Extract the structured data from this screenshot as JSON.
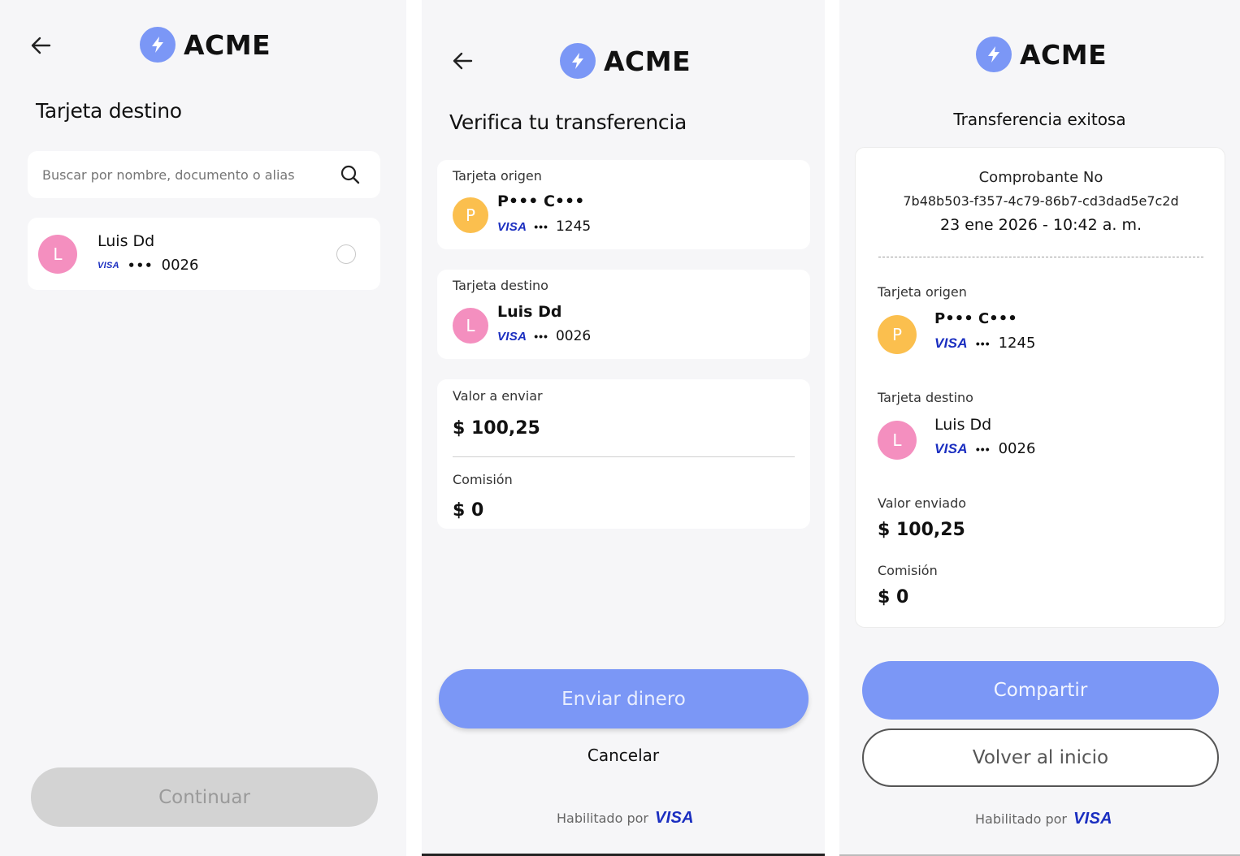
{
  "brand": {
    "name": "ACME",
    "accent": "#7b97f6"
  },
  "colors": {
    "avatar_p": "#fbbf4e",
    "avatar_l": "#f48fbf",
    "visa_blue": "#1a2ec0",
    "disabled": "#d3d3d3",
    "background": "#f6f6f8"
  },
  "icons": {
    "back": "arrow-left-icon",
    "logo": "lightning-bolt-icon",
    "search": "search-icon",
    "radio": "radio-unchecked-icon"
  },
  "screen1": {
    "title": "Tarjeta destino",
    "search_placeholder": "Buscar por nombre, documento o alias",
    "contact": {
      "initial": "L",
      "name": "Luis Dd",
      "network": "VISA",
      "mask": "•••",
      "last4": "0026"
    },
    "continue_label": "Continuar"
  },
  "screen2": {
    "title": "Verifica tu transferencia",
    "origin": {
      "label": "Tarjeta origen",
      "initial": "P",
      "name": "P••• C•••",
      "network": "VISA",
      "mask": "•••",
      "last4": "1245"
    },
    "destination": {
      "label": "Tarjeta destino",
      "initial": "L",
      "name": "Luis Dd",
      "network": "VISA",
      "mask": "•••",
      "last4": "0026"
    },
    "amount": {
      "label": "Valor a enviar",
      "value": "$ 100,25"
    },
    "fee": {
      "label": "Comisión",
      "value": "$ 0"
    },
    "send_label": "Enviar dinero",
    "cancel_label": "Cancelar",
    "footer": {
      "text": "Habilitado por",
      "brand": "VISA"
    }
  },
  "screen3": {
    "title": "Transferencia exitosa",
    "receipt": {
      "label": "Comprobante No",
      "id": "7b48b503-f357-4c79-86b7-cd3dad5e7c2d",
      "datetime": "23 ene 2026 - 10:42 a. m."
    },
    "origin": {
      "label": "Tarjeta origen",
      "initial": "P",
      "name": "P••• C•••",
      "network": "VISA",
      "mask": "•••",
      "last4": "1245"
    },
    "destination": {
      "label": "Tarjeta destino",
      "initial": "L",
      "name": "Luis Dd",
      "network": "VISA",
      "mask": "•••",
      "last4": "0026"
    },
    "amount": {
      "label": "Valor enviado",
      "value": "$ 100,25"
    },
    "fee": {
      "label": "Comisión",
      "value": "$ 0"
    },
    "share_label": "Compartir",
    "home_label": "Volver al inicio",
    "footer": {
      "text": "Habilitado por",
      "brand": "VISA"
    }
  }
}
